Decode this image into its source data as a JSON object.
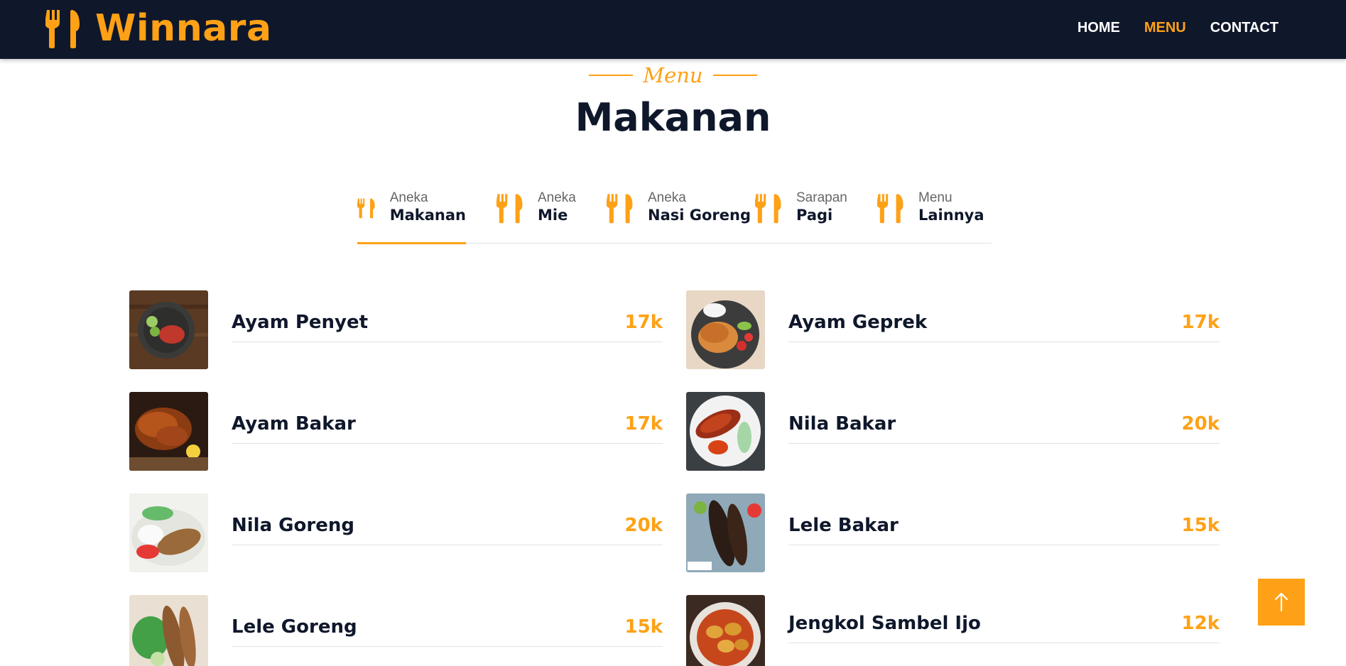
{
  "navbar": {
    "brand": "Winnara",
    "links": [
      {
        "label": "HOME",
        "active": false
      },
      {
        "label": "MENU",
        "active": true
      },
      {
        "label": "CONTACT",
        "active": false
      }
    ]
  },
  "header": {
    "tag": "Menu",
    "title": "Makanan"
  },
  "tabs": [
    {
      "small": "Aneka",
      "big": "Makanan",
      "active": true
    },
    {
      "small": "Aneka",
      "big": "Mie",
      "active": false
    },
    {
      "small": "Aneka",
      "big": "Nasi Goreng",
      "active": false
    },
    {
      "small": "Sarapan",
      "big": "Pagi",
      "active": false
    },
    {
      "small": "Menu",
      "big": "Lainnya",
      "active": false
    }
  ],
  "menu_items": [
    {
      "name": "Ayam Penyet",
      "price": "17k"
    },
    {
      "name": "Ayam Geprek",
      "price": "17k"
    },
    {
      "name": "Ayam Bakar",
      "price": "17k"
    },
    {
      "name": "Nila Bakar",
      "price": "20k"
    },
    {
      "name": "Nila Goreng",
      "price": "20k"
    },
    {
      "name": "Lele Bakar",
      "price": "15k"
    },
    {
      "name": "Lele Goreng",
      "price": "15k"
    },
    {
      "name": "Jengkol Sambel Ijo",
      "price": "12k"
    }
  ],
  "colors": {
    "primary": "#fea116",
    "dark": "#0f172b",
    "divider": "#dee2e6"
  },
  "icons": {
    "brand": "utensils-icon",
    "tab": "utensils-icon",
    "back_to_top": "arrow-up-icon"
  }
}
